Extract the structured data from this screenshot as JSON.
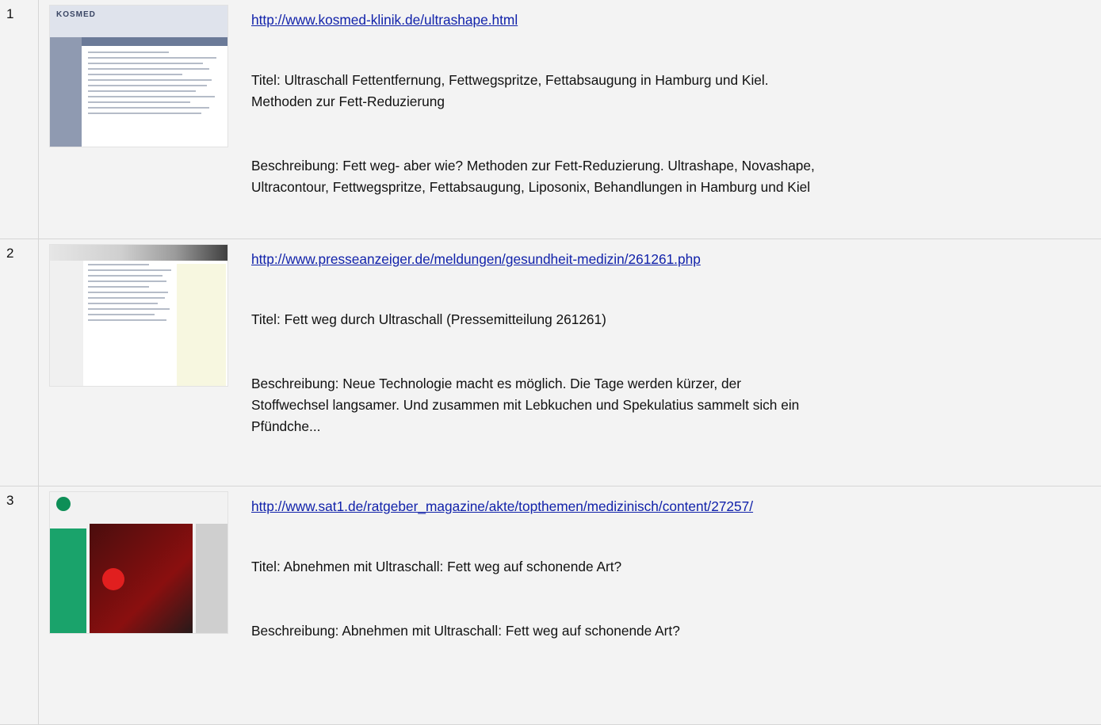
{
  "results": [
    {
      "num": "1",
      "url": "http://www.kosmed-klinik.de/ultrashape.html",
      "title_line1": "Titel: Ultraschall Fettentfernung, Fettwegspritze, Fettabsaugung in Hamburg und Kiel.",
      "title_line2": "Methoden zur Fett-Reduzierung",
      "desc_line1": "Beschreibung: Fett weg- aber wie? Methoden zur Fett-Reduzierung. Ultrashape, Novashape,",
      "desc_line2": "Ultracontour, Fettwegspritze, Fettabsaugung, Liposonix, Behandlungen in Hamburg und Kiel",
      "thumb_logo": "KOSMED"
    },
    {
      "num": "2",
      "url": "http://www.presseanzeiger.de/meldungen/gesundheit-medizin/261261.php",
      "title_line1": "Titel: Fett weg durch Ultraschall (Pressemitteilung 261261)",
      "desc_line1": "Beschreibung: Neue Technologie macht es möglich. Die Tage werden kürzer, der",
      "desc_line2": "Stoffwechsel langsamer. Und zusammen mit Lebkuchen und Spekulatius sammelt sich ein",
      "desc_line3": "Pfündche..."
    },
    {
      "num": "3",
      "url": "http://www.sat1.de/ratgeber_magazine/akte/topthemen/medizinisch/content/27257/",
      "title_line1": "Titel: Abnehmen mit Ultraschall: Fett weg auf schonende Art?",
      "desc_line1": "Beschreibung: Abnehmen mit Ultraschall: Fett weg auf schonende Art?"
    }
  ]
}
